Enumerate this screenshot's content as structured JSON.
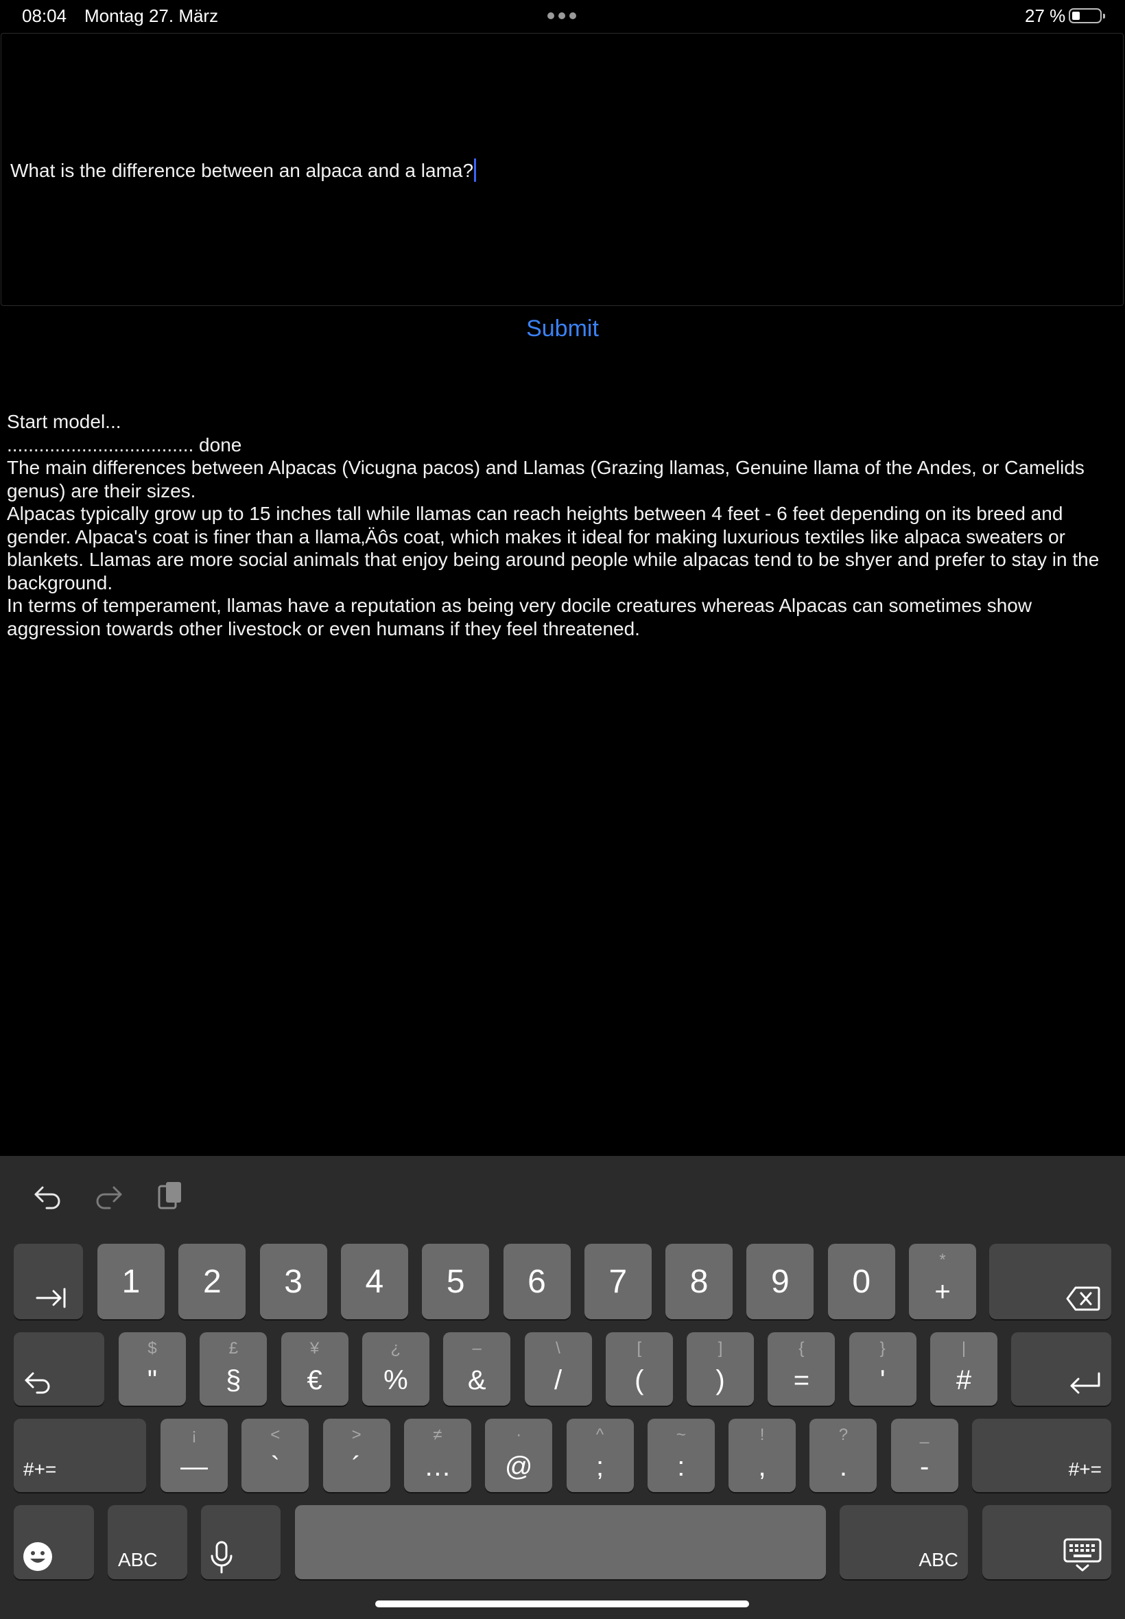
{
  "status": {
    "time": "08:04",
    "date": "Montag 27. März",
    "battery": "27 %",
    "battery_level": 0.27
  },
  "editor": {
    "query": "What is the difference between an alpaca and a lama?"
  },
  "submit_label": "Submit",
  "output": [
    "Start model...",
    "................................... done",
    "The main differences between Alpacas (Vicugna pacos) and Llamas (Grazing llamas, Genuine llama of the Andes, or Camelids genus) are their sizes.",
    "Alpacas typically grow up to 15 inches tall while llamas can reach heights between 4 feet - 6 feet depending on its breed and gender. Alpaca's coat is finer than a llama‚Äôs coat, which makes it ideal for making luxurious textiles like alpaca sweaters or blankets. Llamas are more social animals that enjoy being around people while alpacas tend to be shyer and prefer to stay in the background.",
    "In terms of temperament, llamas have a reputation as being very docile creatures whereas Alpacas can sometimes show aggression towards other livestock or even humans if they feel threatened."
  ],
  "keyboard": {
    "toolbar": [
      "undo-icon",
      "redo-icon",
      "paste-icon"
    ],
    "row1": {
      "tab": "tab-icon",
      "keys": [
        {
          "main": "1"
        },
        {
          "main": "2"
        },
        {
          "main": "3"
        },
        {
          "main": "4"
        },
        {
          "main": "5"
        },
        {
          "main": "6"
        },
        {
          "main": "7"
        },
        {
          "main": "8"
        },
        {
          "main": "9"
        },
        {
          "main": "0"
        },
        {
          "main": "+",
          "sec": "*"
        }
      ],
      "delete": "delete-icon"
    },
    "row2": {
      "undo": "undo-icon",
      "keys": [
        {
          "main": "\"",
          "sec": "$"
        },
        {
          "main": "§",
          "sec": "£"
        },
        {
          "main": "€",
          "sec": "¥"
        },
        {
          "main": "%",
          "sec": "¿"
        },
        {
          "main": "&",
          "sec": "–"
        },
        {
          "main": "/",
          "sec": "\\"
        },
        {
          "main": "(",
          "sec": "["
        },
        {
          "main": ")",
          "sec": "]"
        },
        {
          "main": "=",
          "sec": "{"
        },
        {
          "main": "'",
          "sec": "}"
        },
        {
          "main": "#",
          "sec": "|"
        }
      ],
      "return": "return-icon"
    },
    "row3": {
      "left": "#+=",
      "keys": [
        {
          "main": "—",
          "sec": "¡"
        },
        {
          "main": "`",
          "sec": "<"
        },
        {
          "main": "´",
          "sec": ">"
        },
        {
          "main": "…",
          "sec": "≠"
        },
        {
          "main": "@",
          "sec": "·"
        },
        {
          "main": ";",
          "sec": "^"
        },
        {
          "main": ":",
          "sec": "~"
        },
        {
          "main": ",",
          "sec": "!"
        },
        {
          "main": ".",
          "sec": "?"
        },
        {
          "main": "-",
          "sec": "_"
        }
      ],
      "right": "#+="
    },
    "row4": {
      "emoji": "emoji-icon",
      "abc_left": "ABC",
      "mic": "microphone-icon",
      "abc_right": "ABC",
      "dismiss": "keyboard-dismiss-icon"
    }
  }
}
